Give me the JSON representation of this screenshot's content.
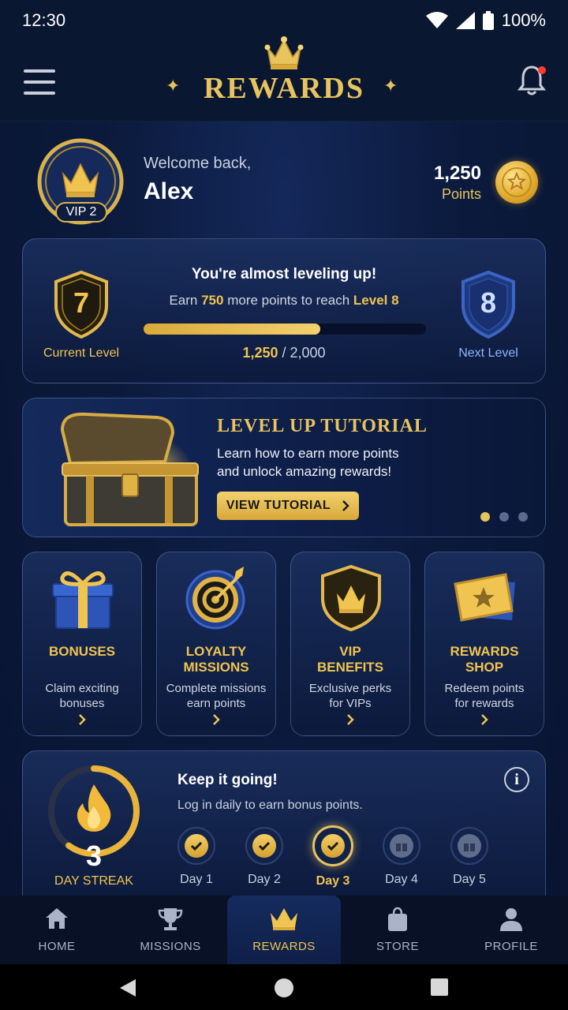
{
  "status_bar": {
    "time": "12:30",
    "battery": "100%"
  },
  "header": {
    "title": "REWARDS"
  },
  "user": {
    "greeting": "Welcome back,",
    "name": "Alex",
    "vip_level": "VIP 2",
    "points": "1,250",
    "points_label": "Points"
  },
  "level": {
    "headline": "You're almost leveling up!",
    "sub_prefix": "Earn",
    "points_needed": "750",
    "sub_middle": "more points to reach",
    "target_level": "Level 8",
    "current_level": "7",
    "current_label": "Current Level",
    "next_level": "8",
    "next_label": "Next Level",
    "progress_current": "1,250",
    "progress_total": "/ 2,000",
    "progress_fraction": 0.625
  },
  "tutorial": {
    "title": "LEVEL UP TUTORIAL",
    "desc_line1": "Learn how to earn more points",
    "desc_line2": "and unlock amazing rewards!",
    "button": "VIEW TUTORIAL",
    "carousel_count": 3,
    "carousel_active": 0
  },
  "features": [
    {
      "icon": "gift-icon",
      "title1": "BONUSES",
      "title2": "",
      "desc1": "Claim exciting",
      "desc2": "bonuses"
    },
    {
      "icon": "target-icon",
      "title1": "LOYALTY",
      "title2": "MISSIONS",
      "desc1": "Complete missions",
      "desc2": "earn points"
    },
    {
      "icon": "vip-shield-icon",
      "title1": "VIP",
      "title2": "BENEFITS",
      "desc1": "Exclusive perks",
      "desc2": "for VIPs"
    },
    {
      "icon": "ticket-icon",
      "title1": "REWARDS",
      "title2": "SHOP",
      "desc1": "Redeem points",
      "desc2": "for rewards"
    }
  ],
  "streak": {
    "count": "3",
    "label": "DAY STREAK",
    "headline": "Keep it going!",
    "sub": "Log in daily to earn bonus points.",
    "progress_fraction": 0.6,
    "days": [
      {
        "label": "Day 1",
        "state": "done"
      },
      {
        "label": "Day 2",
        "state": "done"
      },
      {
        "label": "Day 3",
        "state": "current"
      },
      {
        "label": "Day 4",
        "state": "locked"
      },
      {
        "label": "Day 5",
        "state": "locked"
      }
    ]
  },
  "nav": [
    {
      "label": "HOME",
      "icon": "home-icon"
    },
    {
      "label": "MISSIONS",
      "icon": "trophy-icon"
    },
    {
      "label": "REWARDS",
      "icon": "crown-icon",
      "active": true
    },
    {
      "label": "STORE",
      "icon": "bag-icon"
    },
    {
      "label": "PROFILE",
      "icon": "person-icon"
    }
  ],
  "colors": {
    "accent_gold": "#e8c35e",
    "background": "#0b1a3c",
    "notification": "#ff3b30"
  }
}
